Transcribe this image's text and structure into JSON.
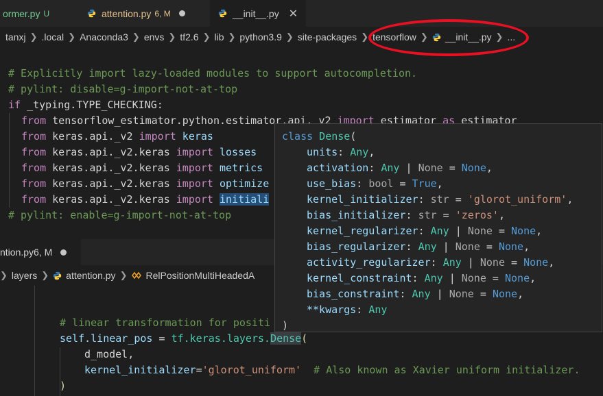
{
  "tabs": [
    {
      "name": "ormer.py",
      "badge": "U"
    },
    {
      "name": "attention.py",
      "badge": "6, M"
    },
    {
      "name": "__init__.py"
    }
  ],
  "breadcrumb": [
    "tanxj",
    ".local",
    "Anaconda3",
    "envs",
    "tf2.6",
    "lib",
    "python3.9",
    "site-packages",
    "tensorflow",
    "__init__.py",
    "..."
  ],
  "editor1": {
    "comment1": "# Explicitly import lazy-loaded modules to support autocompletion.",
    "comment2": "# pylint: disable=g-import-not-at-top",
    "if_kw": "if",
    "if_cond": " _typing.TYPE_CHECKING:",
    "imports": [
      {
        "from": "from",
        "module": " tensorflow_estimator.python.estimator.api._v2 ",
        "imp": "import",
        "name": " estimator",
        "as": " as",
        "alias": " estimator"
      },
      {
        "from": "from",
        "module": " keras.api._v2 ",
        "imp": "import",
        "name": " keras"
      },
      {
        "from": "from",
        "module": " keras.api._v2.keras ",
        "imp": "import",
        "name": " losses"
      },
      {
        "from": "from",
        "module": " keras.api._v2.keras ",
        "imp": "import",
        "name": " metrics"
      },
      {
        "from": "from",
        "module": " keras.api._v2.keras ",
        "imp": "import",
        "name": " optimize"
      },
      {
        "from": "from",
        "module": " keras.api._v2.keras ",
        "imp": "import",
        "name": "initiali"
      }
    ],
    "comment3": "# pylint: enable=g-import-not-at-top"
  },
  "tab2": {
    "name": "ntion.py",
    "badge": "6, M"
  },
  "breadcrumb2": [
    "layers",
    "attention.py",
    "RelPositionMultiHeadedA"
  ],
  "editor2": {
    "comment": "# linear transformation for positi",
    "self": "self",
    "attr": ".linear_pos",
    "eq": " = ",
    "tf": "tf",
    "keras": ".keras",
    "layers": ".layers.",
    "dense": "Dense",
    "open": "(",
    "arg1": "d_model,",
    "kwname": "kernel_initializer",
    "kweq": "=",
    "kwval": "'glorot_uniform'",
    "tail_comment": "  # Also known as Xavier uniform initializer.",
    "close": ")"
  },
  "hover": {
    "head_kw": "class",
    "head_name": " Dense",
    "head_paren": "(",
    "params": [
      {
        "name": "units",
        "colon": ": ",
        "type": "Any",
        "rest": ","
      },
      {
        "name": "activation",
        "colon": ": ",
        "type": "Any",
        "bar": " | ",
        "none": "None",
        "eq": " = ",
        "def": "None",
        "rest": ","
      },
      {
        "name": "use_bias",
        "colon": ": ",
        "type": "bool",
        "eq": " = ",
        "def": "True",
        "rest": ","
      },
      {
        "name": "kernel_initializer",
        "colon": ": ",
        "type": "str",
        "eq": " = ",
        "str": "'glorot_uniform'",
        "rest": ","
      },
      {
        "name": "bias_initializer",
        "colon": ": ",
        "type": "str",
        "eq": " = ",
        "str": "'zeros'",
        "rest": ","
      },
      {
        "name": "kernel_regularizer",
        "colon": ": ",
        "type": "Any",
        "bar": " | ",
        "none": "None",
        "eq": " = ",
        "def": "None",
        "rest": ","
      },
      {
        "name": "bias_regularizer",
        "colon": ": ",
        "type": "Any",
        "bar": " | ",
        "none": "None",
        "eq": " = ",
        "def": "None",
        "rest": ","
      },
      {
        "name": "activity_regularizer",
        "colon": ": ",
        "type": "Any",
        "bar": " | ",
        "none": "None",
        "eq": " = ",
        "def": "None",
        "rest": ","
      },
      {
        "name": "kernel_constraint",
        "colon": ": ",
        "type": "Any",
        "bar": " | ",
        "none": "None",
        "eq": " = ",
        "def": "None",
        "rest": ","
      },
      {
        "name": "bias_constraint",
        "colon": ": ",
        "type": "Any",
        "bar": " | ",
        "none": "None",
        "eq": " = ",
        "def": "None",
        "rest": ","
      },
      {
        "name": "**kwargs",
        "colon": ": ",
        "type": "Any",
        "rest": ""
      }
    ],
    "close": ")"
  },
  "colors": {
    "annotation": "#e81123",
    "accent": "#264f78"
  },
  "icons": [
    "python-file-icon",
    "close-icon",
    "modified-dot-icon",
    "class-symbol-icon"
  ]
}
